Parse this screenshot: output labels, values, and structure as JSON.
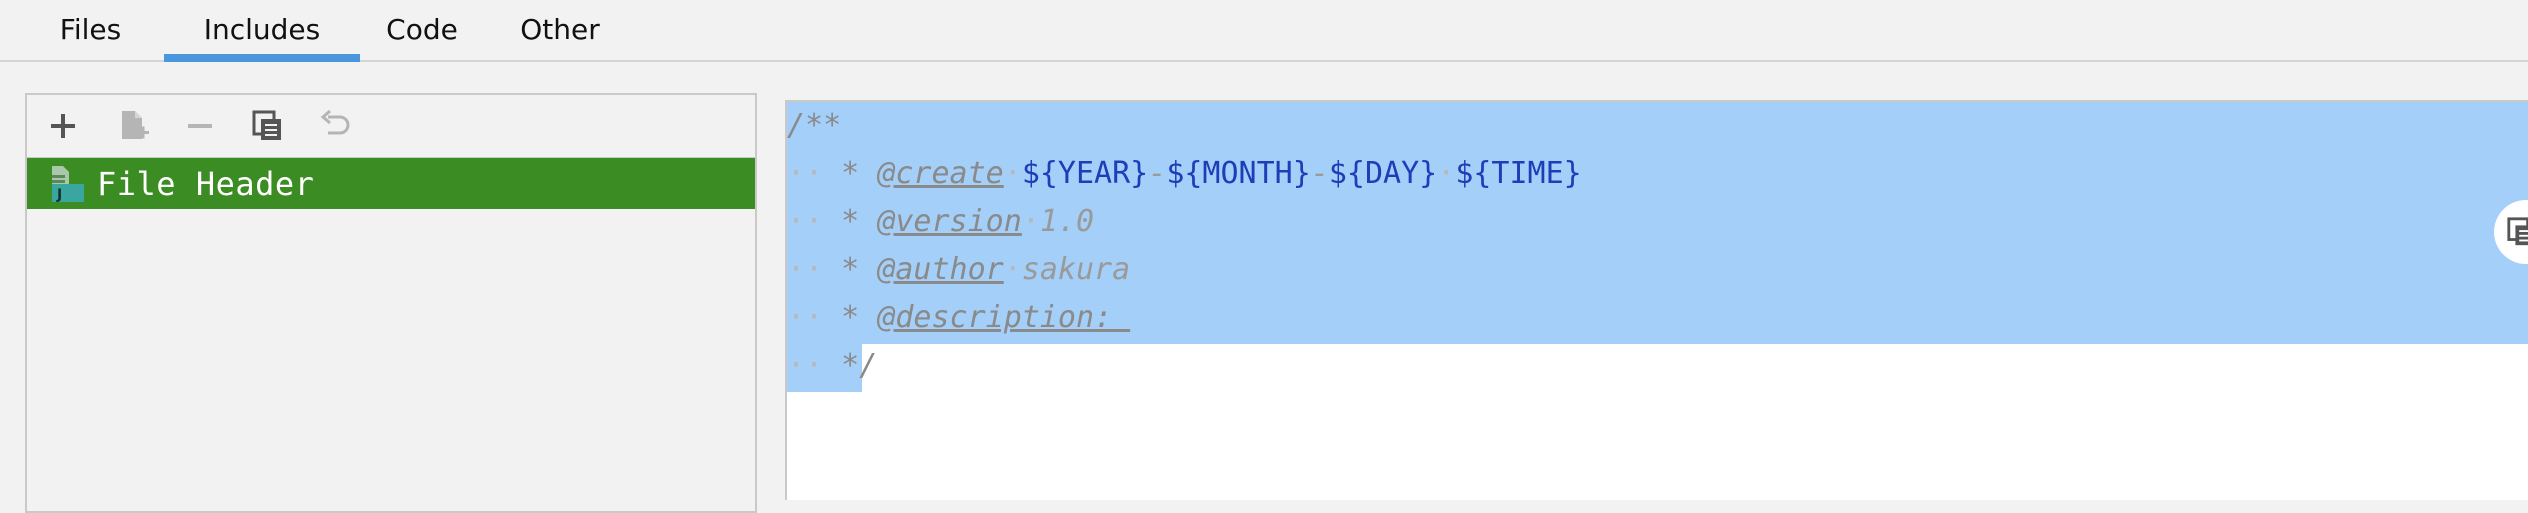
{
  "tabs": [
    {
      "label": "Files",
      "active": false
    },
    {
      "label": "Includes",
      "active": true
    },
    {
      "label": "Code",
      "active": false
    },
    {
      "label": "Other",
      "active": false
    }
  ],
  "toolbar": {
    "buttons": [
      {
        "name": "add",
        "icon": "plus-icon",
        "enabled": true
      },
      {
        "name": "add-child",
        "icon": "add-file-icon",
        "enabled": false
      },
      {
        "name": "remove",
        "icon": "minus-icon",
        "enabled": false
      },
      {
        "name": "copy",
        "icon": "copy-icon",
        "enabled": true
      },
      {
        "name": "reset",
        "icon": "undo-icon",
        "enabled": false
      }
    ]
  },
  "templates": {
    "items": [
      {
        "label": "File Header",
        "icon": "java-file-icon",
        "selected": true
      }
    ]
  },
  "editor": {
    "lines": {
      "l1": "/**",
      "l2_star": " * ",
      "l2_tag": "@create",
      "l2_year": "${YEAR}",
      "l2_dash1": "-",
      "l2_month": "${MONTH}",
      "l2_dash2": "-",
      "l2_day": "${DAY}",
      "l2_time": "${TIME}",
      "l3_star": " * ",
      "l3_tag": "@version",
      "l3_val": "1.0",
      "l4_star": " * ",
      "l4_tag": "@author",
      "l4_val": "sakura",
      "l5_star": " * ",
      "l5_tag": "@description",
      "l5_val": ": ",
      "l6_star": " */"
    }
  },
  "colors": {
    "accent": "#4a97dd",
    "selected_item_bg": "#3b8c23",
    "selection_bg": "#a3cff9",
    "variable_text": "#1c3fb8"
  }
}
